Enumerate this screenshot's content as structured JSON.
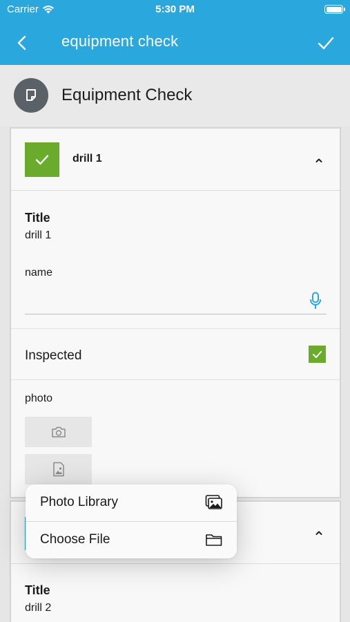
{
  "status": {
    "carrier": "Carrier",
    "time": "5:30 PM"
  },
  "nav": {
    "title": "equipment check",
    "back_icon": "chevron-left-icon",
    "done_icon": "checkmark-icon"
  },
  "form": {
    "title": "Equipment Check",
    "icon": "document-icon"
  },
  "items": [
    {
      "label": "drill 1",
      "completed": true,
      "fields": {
        "title_label": "Title",
        "title_value": "drill 1",
        "name_label": "name",
        "name_value": "",
        "inspected_label": "Inspected",
        "inspected_checked": true,
        "photo_label": "photo"
      }
    },
    {
      "label": "",
      "fields": {
        "title_label": "Title",
        "title_value": "drill 2"
      }
    }
  ],
  "menu": {
    "items": [
      {
        "label": "Photo Library",
        "icon": "photo-library-icon"
      },
      {
        "label": "Choose File",
        "icon": "folder-icon"
      }
    ]
  },
  "colors": {
    "accent": "#2aa8de",
    "success": "#6aab2e",
    "avatar_bg": "#5a6268"
  }
}
